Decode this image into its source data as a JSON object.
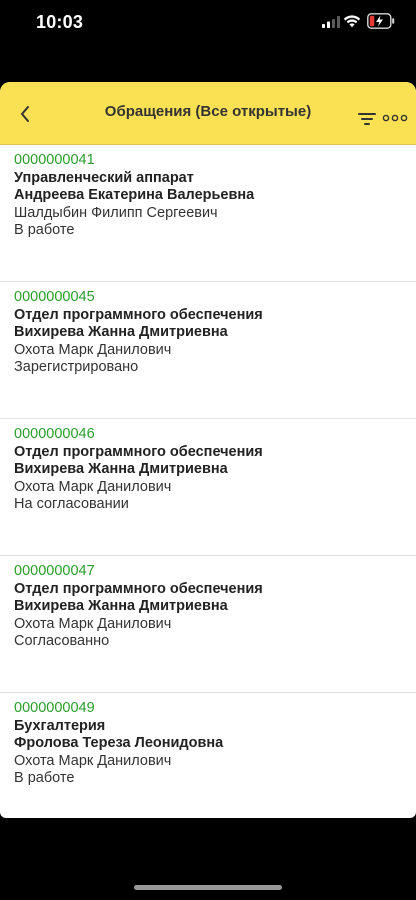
{
  "status_bar": {
    "time": "10:03"
  },
  "header": {
    "title": "Обращения (Все открытые)"
  },
  "colors": {
    "header_bg": "#f9e153",
    "number_text": "#2a9d2a",
    "battery_low": "#e53935"
  },
  "icons": {
    "back": "chevron-left-icon",
    "filter": "filter-icon",
    "more": "more-dots-icon",
    "signal": "signal-icon",
    "wifi": "wifi-icon",
    "battery": "battery-charging-icon"
  },
  "items": [
    {
      "number": "0000000041",
      "department": "Управленческий аппарат",
      "applicant": "Андреева Екатерина Валерьевна",
      "executor": "Шалдыбин Филипп Сергеевич",
      "status": "В работе"
    },
    {
      "number": "0000000045",
      "department": "Отдел программного обеспечения",
      "applicant": "Вихирева Жанна Дмитриевна",
      "executor": "Охота Марк Данилович",
      "status": "Зарегистрировано"
    },
    {
      "number": "0000000046",
      "department": "Отдел программного обеспечения",
      "applicant": "Вихирева Жанна Дмитриевна",
      "executor": "Охота Марк Данилович",
      "status": "На согласовании"
    },
    {
      "number": "0000000047",
      "department": "Отдел программного обеспечения",
      "applicant": "Вихирева Жанна Дмитриевна",
      "executor": "Охота Марк Данилович",
      "status": "Согласованно"
    },
    {
      "number": "0000000049",
      "department": "Бухгалтерия",
      "applicant": "Фролова Тереза Леонидовна",
      "executor": "Охота Марк Данилович",
      "status": "В работе"
    }
  ]
}
